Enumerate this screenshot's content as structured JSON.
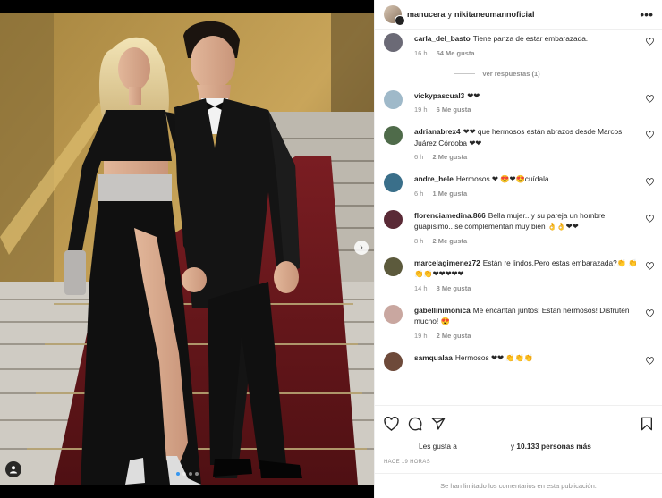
{
  "post": {
    "author": "manucera",
    "connector": "y",
    "coauthor": "nikitaneumannoficial",
    "more_icon": "more-icon"
  },
  "photo": {
    "icons": [
      "chevron-right-icon",
      "user-tag-icon"
    ],
    "carousel_dots": 4,
    "active_dot": 1
  },
  "comments": [
    {
      "user": "carla_del_basto",
      "text": "Tiene panza de estar embarazada.",
      "time": "16 h",
      "likes": "54 Me gusta",
      "replies": "Ver respuestas (1)",
      "avatar_color": "#6b6a76"
    },
    {
      "user": "vickypascual3",
      "text": "❤❤",
      "time": "19 h",
      "likes": "6 Me gusta",
      "avatar_color": "#9fb9c9"
    },
    {
      "user": "adrianabrex4",
      "text": "❤❤ que hermosos están abrazos desde Marcos Juárez Córdoba ❤❤",
      "time": "6 h",
      "likes": "2 Me gusta",
      "avatar_color": "#4f6b4a"
    },
    {
      "user": "andre_hele",
      "text": "Hermosos ❤ 😍❤😍cuídala",
      "time": "6 h",
      "likes": "1 Me gusta",
      "avatar_color": "#3a6f8a"
    },
    {
      "user": "florenciamedina.866",
      "text": "Bella mujer.. y su pareja un hombre guapísimo.. se complementan muy bien 👌👌❤❤",
      "time": "8 h",
      "likes": "2 Me gusta",
      "avatar_color": "#5a2a36"
    },
    {
      "user": "marcelagimenez72",
      "text": "Están re lindos.Pero estas embarazada?👏 👏👏👏❤❤❤❤❤",
      "time": "14 h",
      "likes": "8 Me gusta",
      "avatar_color": "#5c5a3c"
    },
    {
      "user": "gabellinimonica",
      "text": "Me encantan juntos! Están hermosos! Disfruten mucho! 😍",
      "time": "19 h",
      "likes": "2 Me gusta",
      "avatar_color": "#c9a7a0"
    },
    {
      "user": "samqualaa",
      "text": "Hermosos ❤❤ 👏👏👏",
      "time": "",
      "likes": "",
      "avatar_color": "#6e4a3a"
    }
  ],
  "actions": {
    "icons": [
      "heart-icon",
      "comment-icon",
      "share-icon",
      "bookmark-icon"
    ],
    "likes_prefix": "Les gusta a",
    "likes_y": "y",
    "likes_count": "10.133 personas",
    "likes_suffix": "más",
    "time_ago": "HACE 19 HORAS",
    "limited_notice": "Se han limitado los comentarios en esta publicación."
  },
  "colors": {
    "link_blue": "#3897f0",
    "muted": "#8e8e8e",
    "text": "#262626",
    "heart_red": "#ed4956"
  }
}
